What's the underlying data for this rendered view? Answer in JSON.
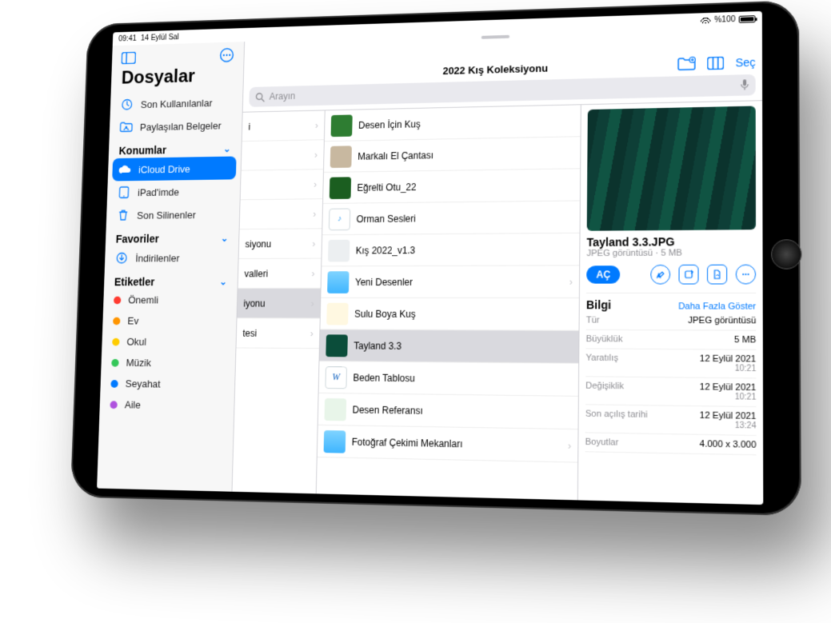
{
  "status": {
    "time": "09:41",
    "date": "14 Eylül Sal",
    "battery": "%100"
  },
  "sidebar": {
    "title": "Dosyalar",
    "recent": "Son Kullanılanlar",
    "shared": "Paylaşılan Belgeler",
    "locations_header": "Konumlar",
    "locations": [
      {
        "label": "iCloud Drive"
      },
      {
        "label": "iPad'imde"
      },
      {
        "label": "Son Silinenler"
      }
    ],
    "favorites_header": "Favoriler",
    "downloads": "İndirilenler",
    "tags_header": "Etiketler",
    "tags": [
      {
        "label": "Önemli",
        "color": "#ff3b30"
      },
      {
        "label": "Ev",
        "color": "#ff9500"
      },
      {
        "label": "Okul",
        "color": "#ffcc00"
      },
      {
        "label": "Müzik",
        "color": "#34c759"
      },
      {
        "label": "Seyahat",
        "color": "#007aff"
      },
      {
        "label": "Aile",
        "color": "#af52de"
      }
    ]
  },
  "header": {
    "title": "2022 Kış Koleksiyonu",
    "search_placeholder": "Arayın",
    "select": "Seç"
  },
  "col0": [
    {
      "label": "i"
    },
    {
      "label": ""
    },
    {
      "label": ""
    },
    {
      "label": ""
    },
    {
      "label": "siyonu"
    },
    {
      "label": "valleri"
    },
    {
      "label": "iyonu",
      "selected": true
    },
    {
      "label": "tesi"
    }
  ],
  "files": [
    {
      "label": "Desen İçin Kuş",
      "thumb": "#2e7d32"
    },
    {
      "label": "Markalı El Çantası",
      "thumb": "#c8b8a0"
    },
    {
      "label": "Eğrelti Otu_22",
      "thumb": "#1b5e20"
    },
    {
      "label": "Orman Sesleri",
      "thumb": "#e3f2fd",
      "audio": true
    },
    {
      "label": "Kış 2022_v1.3",
      "thumb": "#eceff1"
    },
    {
      "label": "Yeni Desenler",
      "thumb": "#60c6ff",
      "folder": true
    },
    {
      "label": "Sulu Boya Kuş",
      "thumb": "#fff8e1"
    },
    {
      "label": "Tayland 3.3",
      "thumb": "#0b4d3a",
      "selected": true
    },
    {
      "label": "Beden Tablosu",
      "thumb": "#e8eaf6",
      "word": true
    },
    {
      "label": "Desen Referansı",
      "thumb": "#e8f5e9"
    },
    {
      "label": "Fotoğraf Çekimi Mekanları",
      "thumb": "#60c6ff",
      "folder": true
    }
  ],
  "preview": {
    "name": "Tayland 3.3.JPG",
    "meta": "JPEG görüntüsü · 5 MB",
    "open": "AÇ",
    "info_header": "Bilgi",
    "more": "Daha Fazla Göster",
    "rows": [
      {
        "k": "Tür",
        "v": "JPEG görüntüsü"
      },
      {
        "k": "Büyüklük",
        "v": "5 MB"
      },
      {
        "k": "Yaratılış",
        "v": "12 Eylül 2021",
        "sub": "10:21"
      },
      {
        "k": "Değişiklik",
        "v": "12 Eylül 2021",
        "sub": "10:21"
      },
      {
        "k": "Son açılış tarihi",
        "v": "12 Eylül 2021",
        "sub": "13:24"
      },
      {
        "k": "Boyutlar",
        "v": "4.000 x 3.000"
      }
    ]
  }
}
